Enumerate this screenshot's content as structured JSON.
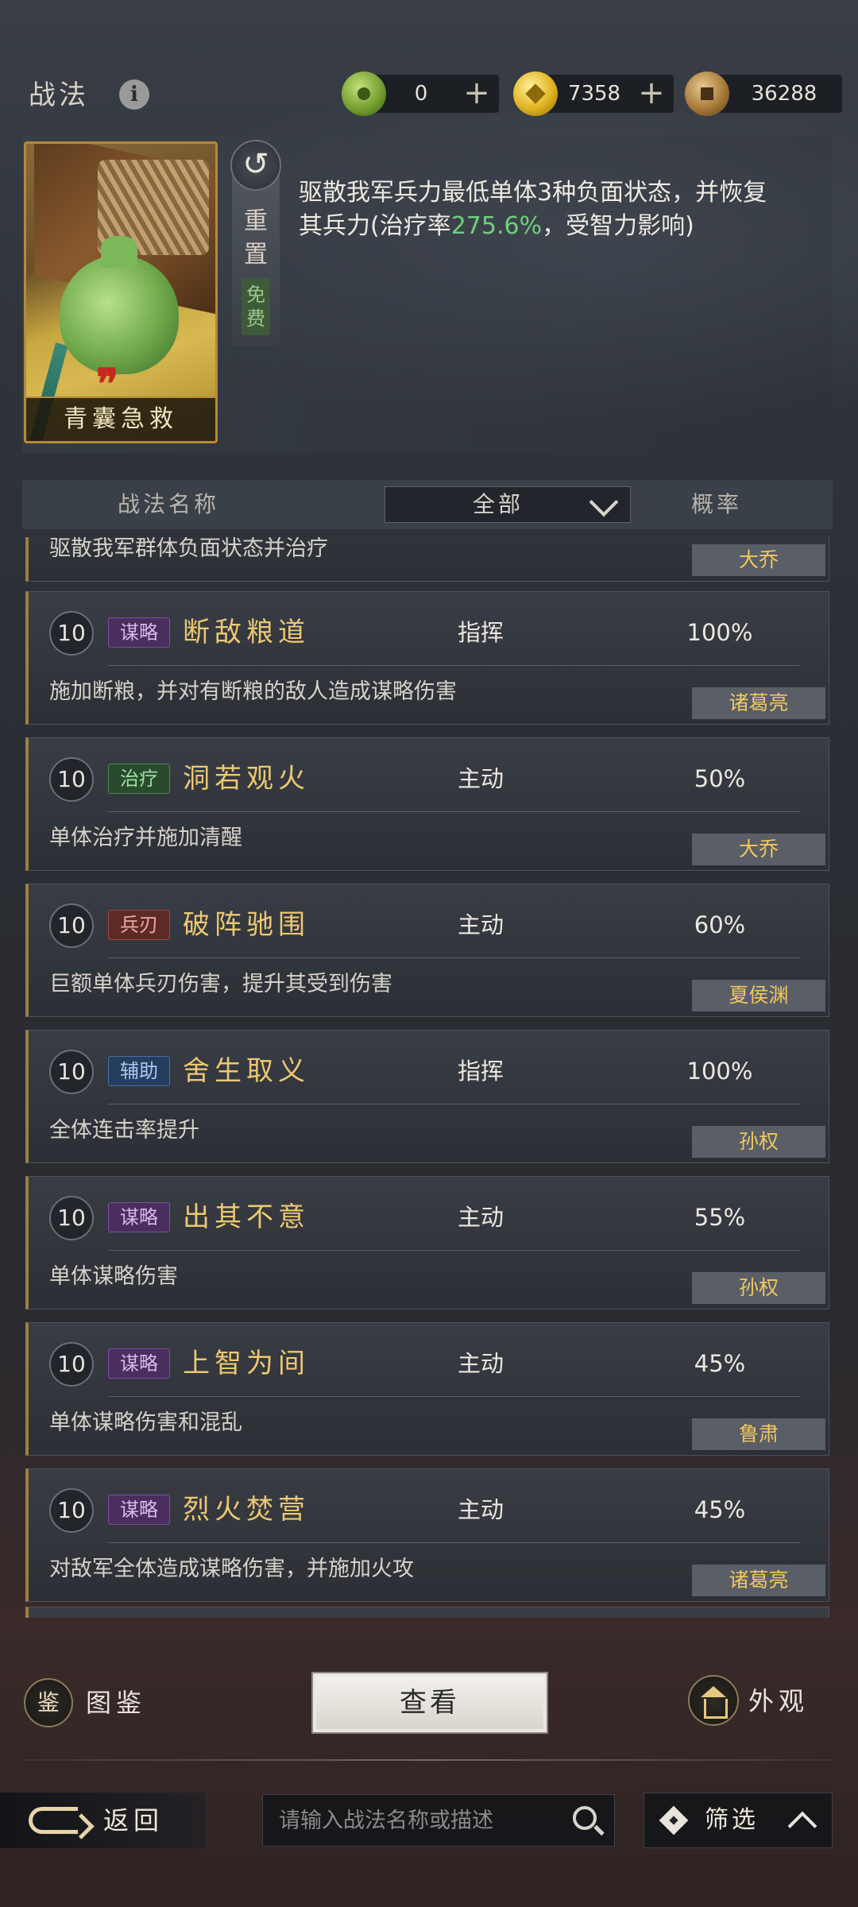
{
  "header": {
    "title": "战法",
    "info_icon": "i",
    "currencies": [
      {
        "icon": "jade-coin-icon",
        "value": "0"
      },
      {
        "icon": "gold-coin-icon",
        "value": "7358"
      },
      {
        "icon": "copper-coin-icon",
        "value": "36288"
      }
    ],
    "plus_symbol": "+"
  },
  "selected": {
    "card_name": "青囊急救",
    "quote_mark": "❞",
    "reset_label": "重置",
    "free_label": "免费",
    "desc_part1": "驱散我军兵力最低单体3种负面状态，并恢复其兵力(治疗率",
    "desc_value": "275.6%",
    "desc_part2": "，受智力影响)"
  },
  "list_header": {
    "name_col": "战法名称",
    "filter_value": "全部",
    "rate_col": "概率"
  },
  "partial_item": {
    "desc": "驱散我军群体负面状态并治疗",
    "hero": "大乔"
  },
  "tactics": [
    {
      "level": "10",
      "tag": "谋略",
      "tag_type": "strategy",
      "name": "断敌粮道",
      "kind": "指挥",
      "rate": "100%",
      "desc": "施加断粮，并对有断粮的敌人造成谋略伤害",
      "hero": "诸葛亮"
    },
    {
      "level": "10",
      "tag": "治疗",
      "tag_type": "heal",
      "name": "洞若观火",
      "kind": "主动",
      "rate": "50%",
      "desc": "单体治疗并施加清醒",
      "hero": "大乔"
    },
    {
      "level": "10",
      "tag": "兵刃",
      "tag_type": "weapon",
      "name": "破阵驰围",
      "kind": "主动",
      "rate": "60%",
      "desc": "巨额单体兵刃伤害，提升其受到伤害",
      "hero": "夏侯渊"
    },
    {
      "level": "10",
      "tag": "辅助",
      "tag_type": "assist",
      "name": "舍生取义",
      "kind": "指挥",
      "rate": "100%",
      "desc": "全体连击率提升",
      "hero": "孙权"
    },
    {
      "level": "10",
      "tag": "谋略",
      "tag_type": "strategy",
      "name": "出其不意",
      "kind": "主动",
      "rate": "55%",
      "desc": "单体谋略伤害",
      "hero": "孙权"
    },
    {
      "level": "10",
      "tag": "谋略",
      "tag_type": "strategy",
      "name": "上智为间",
      "kind": "主动",
      "rate": "45%",
      "desc": "单体谋略伤害和混乱",
      "hero": "鲁肃"
    },
    {
      "level": "10",
      "tag": "谋略",
      "tag_type": "strategy",
      "name": "烈火焚营",
      "kind": "主动",
      "rate": "45%",
      "desc": "对敌军全体造成谋略伤害，并施加火攻",
      "hero": "诸葛亮"
    }
  ],
  "footer": {
    "codex_icon_char": "鉴",
    "codex_label": "图鉴",
    "view_label": "查看",
    "skin_label": "外观",
    "back_label": "返回",
    "search_placeholder": "请输入战法名称或描述",
    "filter_label": "筛选"
  },
  "colors": {
    "accent_gold": "#ecc872",
    "heal_green": "#6ed07a",
    "hero_gold": "#f0c860"
  }
}
